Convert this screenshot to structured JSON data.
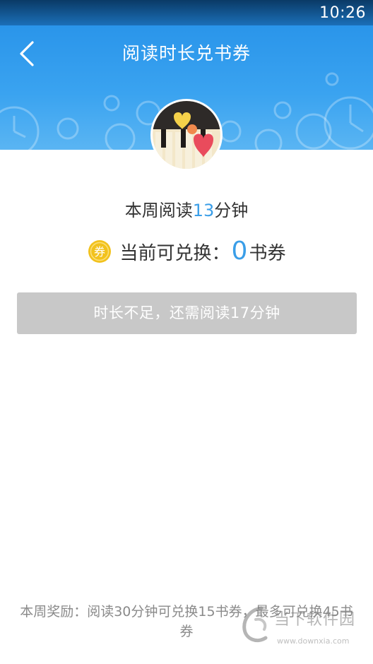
{
  "status_bar": {
    "time": "10:26"
  },
  "header": {
    "title": "阅读时长兑书券",
    "back_icon": "chevron-left-icon"
  },
  "colors": {
    "header_blue": "#3aa3f0",
    "accent_blue": "#3a9ee8",
    "button_disabled": "#c8c8c8",
    "coin_gold": "#f2c21d"
  },
  "weekly": {
    "prefix": "本周阅读",
    "minutes": "13",
    "suffix": "分钟"
  },
  "exchange": {
    "coin_icon": "coin-quan-icon",
    "coin_glyph": "券",
    "label": "当前可兑换：",
    "count": "0",
    "unit": "书券"
  },
  "action_button": {
    "label": "时长不足，还需阅读17分钟"
  },
  "footer": {
    "reward_note": "本周奖励：阅读30分钟可兑换15书券，最多可兑换45书券"
  },
  "watermark": {
    "title": "当下软件园",
    "url": "www.downxia.com"
  }
}
